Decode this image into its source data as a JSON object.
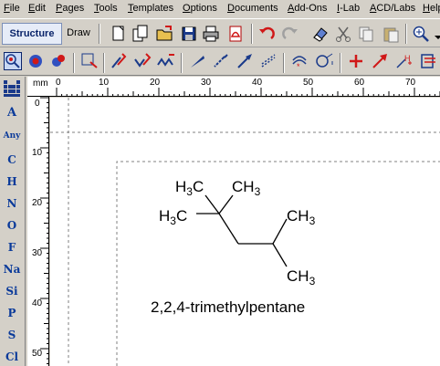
{
  "menu": [
    "File",
    "Edit",
    "Pages",
    "Tools",
    "Templates",
    "Options",
    "Documents",
    "Add-Ons",
    "I-Lab",
    "ACD/Labs",
    "Help"
  ],
  "tabs": {
    "structure": "Structure",
    "draw": "Draw"
  },
  "elements": [
    "A",
    "Any",
    "C",
    "H",
    "N",
    "O",
    "F",
    "Na",
    "Si",
    "P",
    "S",
    "Cl"
  ],
  "ruler": {
    "unit": "mm",
    "h_ticks": [
      "0",
      "10",
      "20",
      "30",
      "40",
      "50",
      "60",
      "70"
    ],
    "v_ticks": [
      "0",
      "10",
      "20",
      "30",
      "40",
      "50"
    ]
  },
  "molecule": {
    "name": "2,2,4-trimethylpentane",
    "labels": {
      "top_left": "H",
      "top_right": "CH",
      "left": "H",
      "left_c": "C",
      "right_upper": "CH",
      "right_lower": "CH",
      "sub3": "3"
    }
  },
  "colors": {
    "accent": "#0a246a",
    "element": "#0a3a9a",
    "red": "#d01818"
  }
}
